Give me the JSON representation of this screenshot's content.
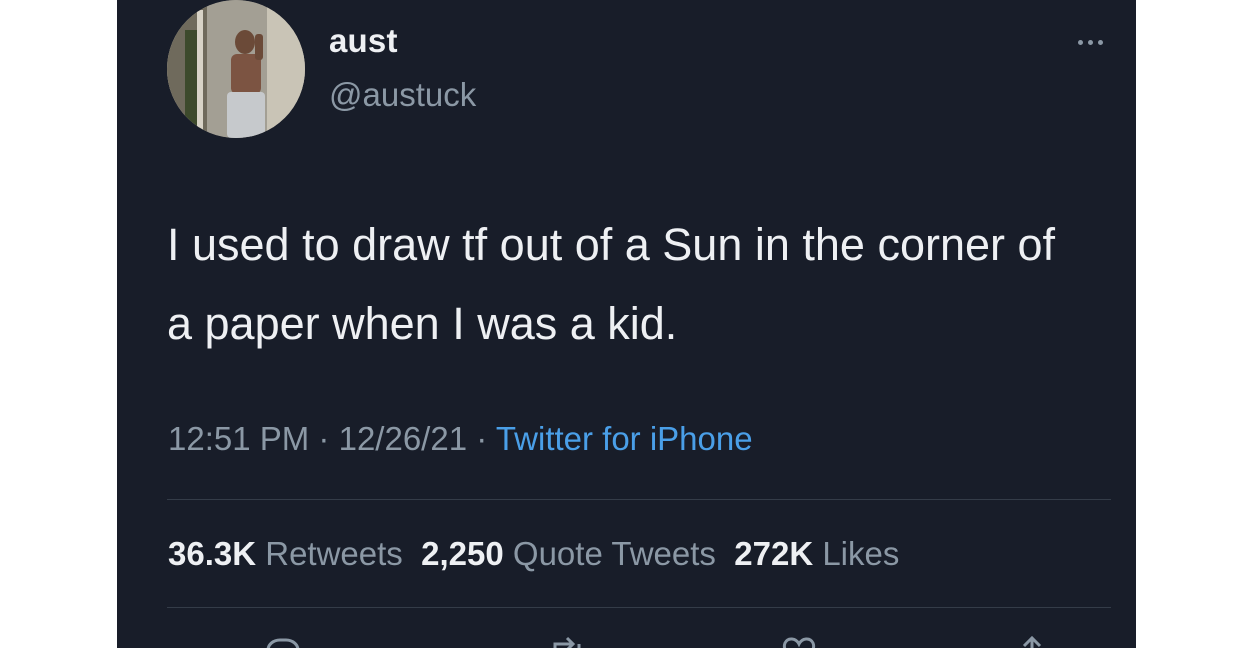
{
  "tweet": {
    "author": {
      "display_name": "aust",
      "handle": "@austuck"
    },
    "text": "I used to draw tf out of a Sun in the corner of a paper when I was a kid.",
    "time": "12:51 PM",
    "date": "12/26/21",
    "separator": "·",
    "source": "Twitter for iPhone",
    "stats": {
      "retweets_count": "36.3K",
      "retweets_label": "Retweets",
      "quotes_count": "2,250",
      "quotes_label": "Quote Tweets",
      "likes_count": "272K",
      "likes_label": "Likes"
    }
  },
  "icons": {
    "more": "more-horizontal-icon",
    "reply": "reply-icon",
    "retweet": "retweet-icon",
    "like": "heart-icon",
    "share": "share-icon"
  },
  "colors": {
    "background": "#181d29",
    "text_primary": "#eef0f3",
    "text_secondary": "#8b98a5",
    "link": "#4a9fe8",
    "divider": "#343c48"
  }
}
